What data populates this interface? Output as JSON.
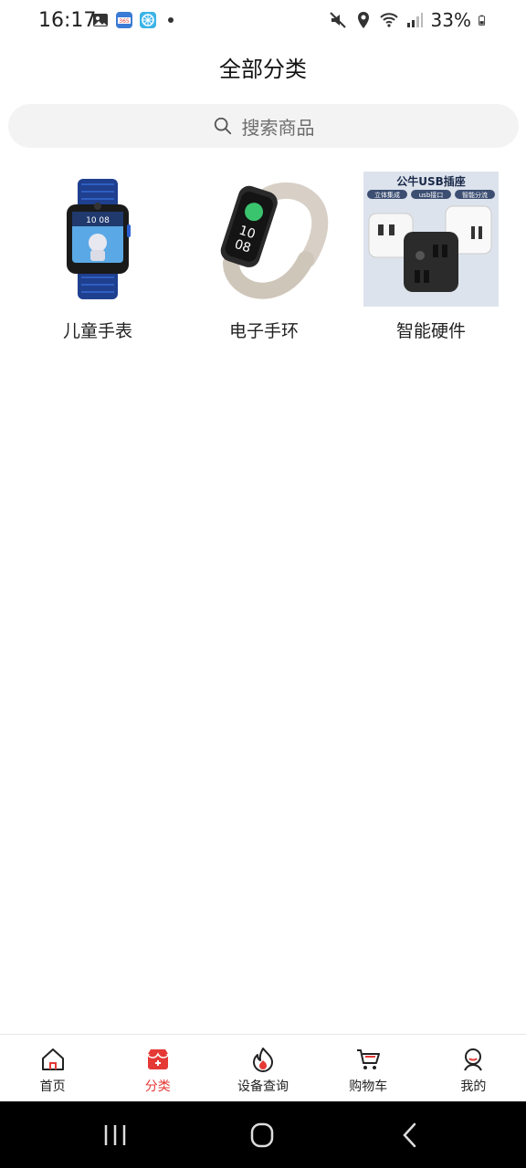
{
  "status_bar": {
    "time": "16:17",
    "battery_text": "33%",
    "icons_left": [
      "gallery-icon",
      "app-365-icon",
      "app-snow-icon",
      "notification-dot"
    ],
    "icons_right": [
      "mute-icon",
      "location-icon",
      "wifi-icon",
      "signal-icon",
      "battery-icon"
    ]
  },
  "header": {
    "title": "全部分类"
  },
  "search": {
    "placeholder": "搜索商品"
  },
  "categories": [
    {
      "label": "儿童手表",
      "image": "kids-watch-image"
    },
    {
      "label": "电子手环",
      "image": "smart-band-image"
    },
    {
      "label": "智能硬件",
      "image": "smart-plug-image",
      "image_text": {
        "title": "公牛USB插座",
        "tags": [
          "立体集成",
          "usb接口",
          "智能分流"
        ]
      }
    }
  ],
  "tabbar": {
    "items": [
      {
        "label": "首页",
        "icon": "home-icon",
        "active": false
      },
      {
        "label": "分类",
        "icon": "shop-icon",
        "active": true
      },
      {
        "label": "设备查询",
        "icon": "flame-icon",
        "active": false
      },
      {
        "label": "购物车",
        "icon": "cart-icon",
        "active": false
      },
      {
        "label": "我的",
        "icon": "profile-icon",
        "active": false
      }
    ],
    "active_color": "#e53935"
  },
  "system_nav": {
    "buttons": [
      "recents",
      "home",
      "back"
    ]
  }
}
